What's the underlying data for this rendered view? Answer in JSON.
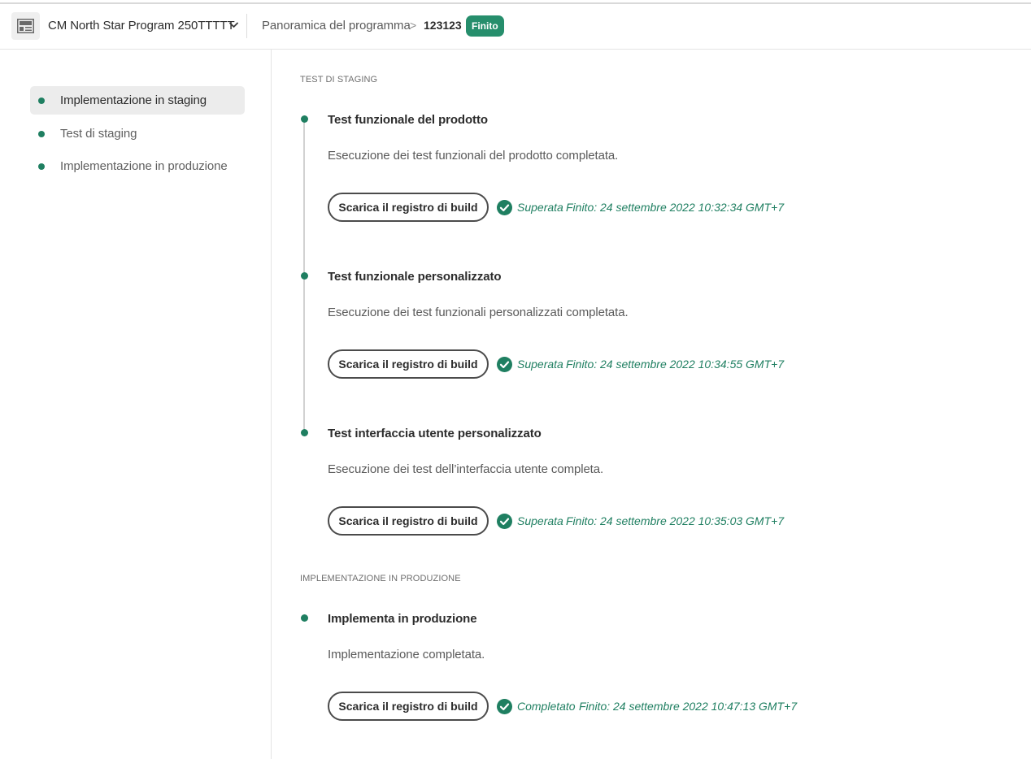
{
  "header": {
    "program_name": "CM North Star Program 250TTTTT",
    "breadcrumb_link": "Panoramica del programma",
    "breadcrumb_separator": ">",
    "breadcrumb_current": "123123",
    "status_badge": "Finito",
    "status_color": "#268e6c",
    "icons": [
      "program-icon",
      "chevron-down-icon"
    ]
  },
  "sidebar": {
    "items": [
      {
        "label": "Implementazione in staging",
        "selected": true
      },
      {
        "label": "Test di staging",
        "selected": false
      },
      {
        "label": "Implementazione in produzione",
        "selected": false
      }
    ]
  },
  "sections": [
    {
      "heading": "TEST DI STAGING",
      "steps": [
        {
          "title": "Test funzionale del prodotto",
          "description": "Esecuzione dei test funzionali del prodotto completata.",
          "button_label": "Scarica il registro di build",
          "result_status": "Superata",
          "result_time": "Finito: 24 settembre 2022 10:32:34 GMT+7"
        },
        {
          "title": "Test funzionale personalizzato",
          "description": "Esecuzione dei test funzionali personalizzati completata.",
          "button_label": "Scarica il registro di build",
          "result_status": "Superata",
          "result_time": "Finito: 24 settembre 2022 10:34:55 GMT+7"
        },
        {
          "title": "Test interfaccia utente personalizzato",
          "description": "Esecuzione dei test dell’interfaccia utente completa.",
          "button_label": "Scarica il registro di build",
          "result_status": "Superata",
          "result_time": "Finito: 24 settembre 2022 10:35:03 GMT+7"
        }
      ]
    },
    {
      "heading": "IMPLEMENTAZIONE IN PRODUZIONE",
      "steps": [
        {
          "title": "Implementa in produzione",
          "description": "Implementazione completata.",
          "button_label": "Scarica il registro di build",
          "result_status": "Completato",
          "result_time": "Finito: 24 settembre 2022 10:47:13 GMT+7"
        }
      ]
    }
  ],
  "colors": {
    "accent_green": "#1f7f61",
    "selected_background": "#ececec"
  }
}
